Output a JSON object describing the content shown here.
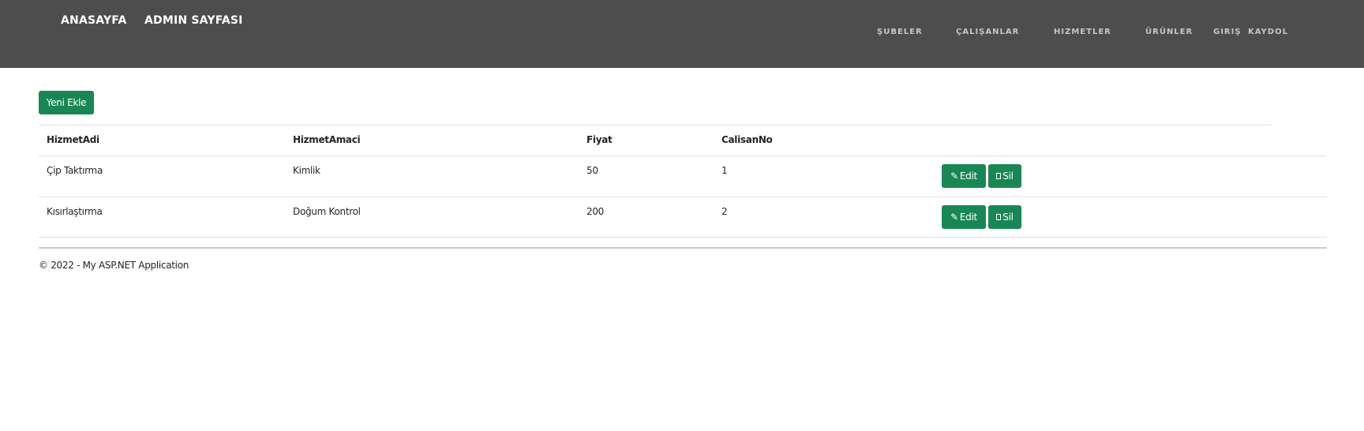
{
  "navbar": {
    "brand_links": [
      "ANASAYFA",
      "ADMIN SAYFASI"
    ],
    "menu": [
      "ŞUBELER",
      "ÇALIŞANLAR",
      "HIZMETLER",
      "ÜRÜNLER",
      "GIRIŞ",
      "KAYDOL"
    ],
    "background": "#4d4d4d"
  },
  "toolbar": {
    "add_label": "Yeni Ekle"
  },
  "table": {
    "headers": [
      "HizmetAdi",
      "HizmetAmaci",
      "Fiyat",
      "CalisanNo"
    ],
    "rows": [
      {
        "HizmetAdi": "Çip Taktırma",
        "HizmetAmaci": "Kimlik",
        "Fiyat": "50",
        "CalisanNo": "1"
      },
      {
        "HizmetAdi": "Kısırlaştırma",
        "HizmetAmaci": "Doğum Kontrol",
        "Fiyat": "200",
        "CalisanNo": "2"
      }
    ],
    "actions": {
      "edit_label": "Edit",
      "delete_label": "Sil",
      "edit_icon": "pencil-icon",
      "delete_icon": "trash-icon"
    }
  },
  "footer": {
    "text": "© 2022 - My ASP.NET Application"
  },
  "colors": {
    "accent": "#198754",
    "navbar": "#4d4d4d"
  }
}
